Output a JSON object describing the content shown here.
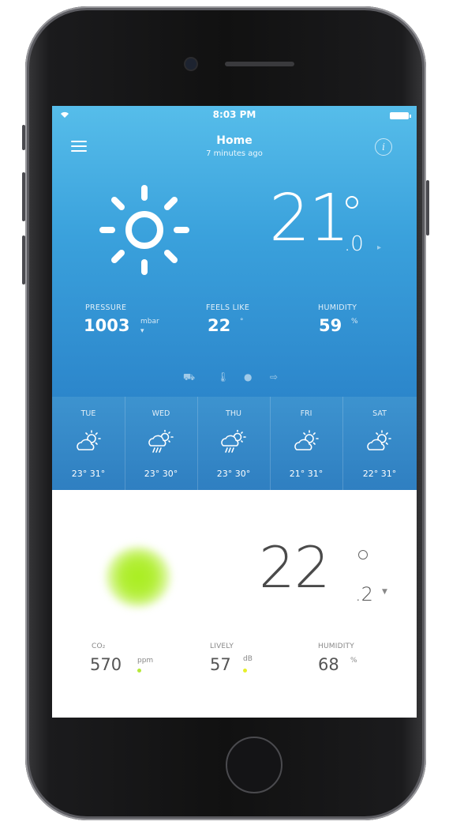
{
  "status_bar": {
    "time": "8:03 PM"
  },
  "header": {
    "title": "Home",
    "subtitle": "7 minutes ago"
  },
  "outdoor": {
    "temp_int": "21",
    "temp_dec": ".0",
    "pressure": {
      "label": "PRESSURE",
      "value": "1003",
      "unit": "mbar"
    },
    "feels_like": {
      "label": "FEELS LIKE",
      "value": "22",
      "unit": "°"
    },
    "humidity": {
      "label": "HUMIDITY",
      "value": "59",
      "unit": "%"
    },
    "icons": [
      "car-icon",
      "thermometer-icon",
      "drop-icon",
      "wind-arrow-icon"
    ]
  },
  "forecast": [
    {
      "day": "TUE",
      "icon": "partly-sunny-icon",
      "temps": "23° 31°"
    },
    {
      "day": "WED",
      "icon": "rain-sun-icon",
      "temps": "23° 30°"
    },
    {
      "day": "THU",
      "icon": "rain-sun-icon",
      "temps": "23° 30°"
    },
    {
      "day": "FRI",
      "icon": "partly-sunny-icon",
      "temps": "21° 31°"
    },
    {
      "day": "SAT",
      "icon": "partly-sunny-icon",
      "temps": "22° 31°"
    }
  ],
  "indoor": {
    "temp_int": "22",
    "temp_dec": ".2",
    "co2": {
      "label": "CO₂",
      "value": "570",
      "unit": "ppm"
    },
    "noise": {
      "label": "LIVELY",
      "value": "57",
      "unit": "dB"
    },
    "humidity": {
      "label": "HUMIDITY",
      "value": "68",
      "unit": "%"
    }
  },
  "colors": {
    "sky_top": "#56bdea",
    "sky_bottom": "#2c86cb",
    "air_quality_green": "#a8ed1d",
    "dot_yellow": "#e6ef2a"
  }
}
